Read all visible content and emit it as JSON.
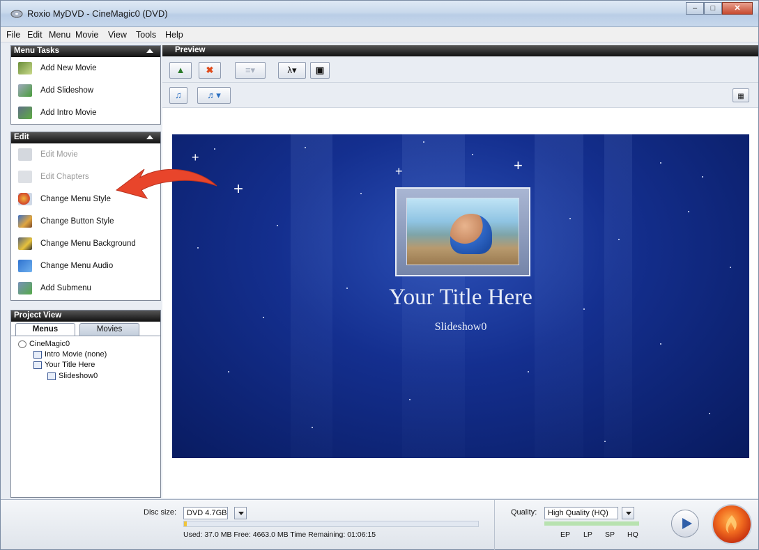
{
  "window": {
    "title": "Roxio MyDVD - CineMagic0  (DVD)"
  },
  "menubar": [
    "File",
    "Edit",
    "Menu",
    "Movie",
    "View",
    "Tools",
    "Help"
  ],
  "menu_tasks": {
    "header": "Menu Tasks",
    "items": [
      "Add New Movie",
      "Add Slideshow",
      "Add Intro Movie"
    ]
  },
  "edit": {
    "header": "Edit",
    "items": [
      "Edit Movie",
      "Edit Chapters",
      "Change Menu Style",
      "Change Button Style",
      "Change Menu Background",
      "Change Menu Audio",
      "Add Submenu"
    ]
  },
  "project_view": {
    "header": "Project View",
    "tabs": [
      "Menus",
      "Movies"
    ],
    "tree": [
      "CineMagic0",
      "Intro Movie (none)",
      "Your Title Here",
      "Slideshow0"
    ]
  },
  "preview": {
    "header": "Preview",
    "menu_title": "Your Title Here",
    "menu_subtitle": "Slideshow0"
  },
  "status": {
    "disc_size_label": "Disc size:",
    "disc_size_value": "DVD 4.7GB",
    "usage_text": "Used: 37.0 MB  Free: 4663.0 MB  Time Remaining: 01:06:15",
    "quality_label": "Quality:",
    "quality_value": "High Quality (HQ)",
    "quality_levels": [
      "EP",
      "LP",
      "SP",
      "HQ"
    ]
  },
  "colors": {
    "accent_arrow": "#e8452b",
    "menu_background": "#142f8f"
  }
}
